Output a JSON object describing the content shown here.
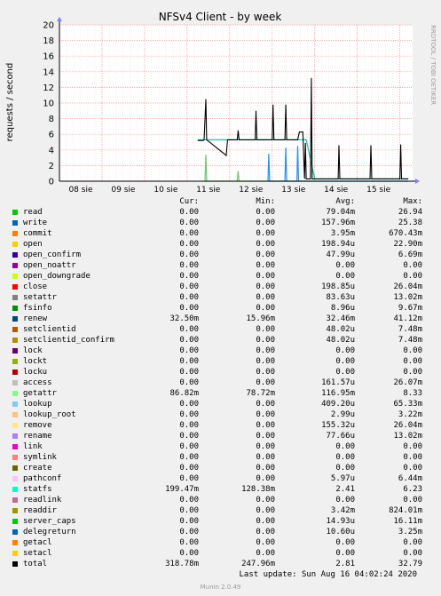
{
  "chart_data": {
    "type": "line",
    "title": "NFSv4 Client - by week",
    "ylabel": "requests / second",
    "watermark": "RRDTOOL / TOBI OETIKER",
    "ylim": [
      0,
      20
    ],
    "yticks": [
      0,
      2,
      4,
      6,
      8,
      10,
      12,
      14,
      16,
      18,
      20
    ],
    "xlim": [
      0,
      8.3
    ],
    "xticks": [
      {
        "label": "08 sie",
        "x": 0.5
      },
      {
        "label": "09 sie",
        "x": 1.5
      },
      {
        "label": "10 sie",
        "x": 2.5
      },
      {
        "label": "11 sie",
        "x": 3.5
      },
      {
        "label": "12 sie",
        "x": 4.5
      },
      {
        "label": "13 sie",
        "x": 5.5
      },
      {
        "label": "14 sie",
        "x": 6.5
      },
      {
        "label": "15 sie",
        "x": 7.5
      }
    ],
    "series": [
      {
        "name": "getattr",
        "color": "#66cc66",
        "points": [
          [
            3.4,
            0
          ],
          [
            3.42,
            0
          ],
          [
            3.44,
            3.4
          ],
          [
            3.46,
            0
          ],
          [
            4.1,
            0
          ],
          [
            4.18,
            0
          ],
          [
            4.2,
            1.3
          ],
          [
            4.22,
            0
          ],
          [
            6.5,
            0
          ],
          [
            8.2,
            0
          ]
        ]
      },
      {
        "name": "write",
        "color": "#1e90ff",
        "points": [
          [
            4.9,
            0
          ],
          [
            4.92,
            3.5
          ],
          [
            4.94,
            0
          ],
          [
            5.3,
            0
          ],
          [
            5.32,
            4.3
          ],
          [
            5.34,
            0
          ],
          [
            5.58,
            0
          ],
          [
            5.6,
            4.5
          ],
          [
            5.62,
            0
          ],
          [
            8.2,
            0
          ]
        ]
      },
      {
        "name": "statfs",
        "color": "#00ccaa",
        "points": [
          [
            3.25,
            5.3
          ],
          [
            3.38,
            5.3
          ],
          [
            3.92,
            5.3
          ],
          [
            4.0,
            5.3
          ],
          [
            5.8,
            5.3
          ],
          [
            6.0,
            0.3
          ],
          [
            8.2,
            0.3
          ]
        ]
      },
      {
        "name": "total",
        "color": "#000000",
        "points": [
          [
            3.25,
            5.2
          ],
          [
            3.38,
            5.2
          ],
          [
            3.4,
            5.3
          ],
          [
            3.44,
            10.5
          ],
          [
            3.46,
            5.3
          ],
          [
            3.92,
            3.3
          ],
          [
            3.95,
            5.3
          ],
          [
            4.18,
            5.3
          ],
          [
            4.2,
            6.5
          ],
          [
            4.22,
            5.3
          ],
          [
            4.6,
            5.3
          ],
          [
            4.62,
            9.0
          ],
          [
            4.64,
            5.3
          ],
          [
            5.0,
            5.3
          ],
          [
            5.02,
            9.8
          ],
          [
            5.04,
            5.3
          ],
          [
            5.3,
            5.3
          ],
          [
            5.32,
            9.8
          ],
          [
            5.34,
            5.3
          ],
          [
            5.6,
            5.3
          ],
          [
            5.64,
            6.3
          ],
          [
            5.72,
            6.3
          ],
          [
            5.76,
            0.3
          ],
          [
            5.78,
            4.9
          ],
          [
            5.8,
            0.3
          ],
          [
            5.9,
            0.3
          ],
          [
            5.92,
            13.2
          ],
          [
            5.94,
            0.3
          ],
          [
            6.5,
            0.3
          ],
          [
            6.55,
            0.3
          ],
          [
            6.57,
            4.6
          ],
          [
            6.59,
            0.3
          ],
          [
            7.3,
            0.3
          ],
          [
            7.32,
            4.6
          ],
          [
            7.34,
            0.3
          ],
          [
            8.0,
            0.3
          ],
          [
            8.02,
            4.7
          ],
          [
            8.04,
            0.3
          ],
          [
            8.2,
            0.3
          ]
        ]
      }
    ],
    "grid": true
  },
  "legend": {
    "headers": {
      "cur": "Cur:",
      "min": "Min:",
      "avg": "Avg:",
      "max": "Max:"
    },
    "rows": [
      {
        "name": "read",
        "color": "#00cc00",
        "cur": "0.00",
        "min": "0.00",
        "avg": "79.04m",
        "max": "26.94"
      },
      {
        "name": "write",
        "color": "#0066b3",
        "cur": "0.00",
        "min": "0.00",
        "avg": "157.96m",
        "max": "25.38"
      },
      {
        "name": "commit",
        "color": "#ff8000",
        "cur": "0.00",
        "min": "0.00",
        "avg": "3.95m",
        "max": "670.43m"
      },
      {
        "name": "open",
        "color": "#ffcc00",
        "cur": "0.00",
        "min": "0.00",
        "avg": "198.94u",
        "max": "22.90m"
      },
      {
        "name": "open_confirm",
        "color": "#330099",
        "cur": "0.00",
        "min": "0.00",
        "avg": "47.99u",
        "max": "6.69m"
      },
      {
        "name": "open_noattr",
        "color": "#990099",
        "cur": "0.00",
        "min": "0.00",
        "avg": "0.00",
        "max": "0.00"
      },
      {
        "name": "open_downgrade",
        "color": "#ccff00",
        "cur": "0.00",
        "min": "0.00",
        "avg": "0.00",
        "max": "0.00"
      },
      {
        "name": "close",
        "color": "#ff0000",
        "cur": "0.00",
        "min": "0.00",
        "avg": "198.85u",
        "max": "26.04m"
      },
      {
        "name": "setattr",
        "color": "#808080",
        "cur": "0.00",
        "min": "0.00",
        "avg": "83.63u",
        "max": "13.02m"
      },
      {
        "name": "fsinfo",
        "color": "#008f00",
        "cur": "0.00",
        "min": "0.00",
        "avg": "8.96u",
        "max": "9.67m"
      },
      {
        "name": "renew",
        "color": "#00487d",
        "cur": "32.50m",
        "min": "15.96m",
        "avg": "32.46m",
        "max": "41.12m"
      },
      {
        "name": "setclientid",
        "color": "#b35a00",
        "cur": "0.00",
        "min": "0.00",
        "avg": "48.02u",
        "max": "7.48m"
      },
      {
        "name": "setclientid_confirm",
        "color": "#b38f00",
        "cur": "0.00",
        "min": "0.00",
        "avg": "48.02u",
        "max": "7.48m"
      },
      {
        "name": "lock",
        "color": "#6b006b",
        "cur": "0.00",
        "min": "0.00",
        "avg": "0.00",
        "max": "0.00"
      },
      {
        "name": "lockt",
        "color": "#8fb300",
        "cur": "0.00",
        "min": "0.00",
        "avg": "0.00",
        "max": "0.00"
      },
      {
        "name": "locku",
        "color": "#b30000",
        "cur": "0.00",
        "min": "0.00",
        "avg": "0.00",
        "max": "0.00"
      },
      {
        "name": "access",
        "color": "#bebebe",
        "cur": "0.00",
        "min": "0.00",
        "avg": "161.57u",
        "max": "26.07m"
      },
      {
        "name": "getattr",
        "color": "#80ff80",
        "cur": "86.82m",
        "min": "78.72m",
        "avg": "116.95m",
        "max": "8.33"
      },
      {
        "name": "lookup",
        "color": "#80c9ff",
        "cur": "0.00",
        "min": "0.00",
        "avg": "409.20u",
        "max": "65.33m"
      },
      {
        "name": "lookup_root",
        "color": "#ffc080",
        "cur": "0.00",
        "min": "0.00",
        "avg": "2.99u",
        "max": "3.22m"
      },
      {
        "name": "remove",
        "color": "#ffe680",
        "cur": "0.00",
        "min": "0.00",
        "avg": "155.32u",
        "max": "26.04m"
      },
      {
        "name": "rename",
        "color": "#aa80ff",
        "cur": "0.00",
        "min": "0.00",
        "avg": "77.66u",
        "max": "13.02m"
      },
      {
        "name": "link",
        "color": "#ee00cc",
        "cur": "0.00",
        "min": "0.00",
        "avg": "0.00",
        "max": "0.00"
      },
      {
        "name": "symlink",
        "color": "#ff8080",
        "cur": "0.00",
        "min": "0.00",
        "avg": "0.00",
        "max": "0.00"
      },
      {
        "name": "create",
        "color": "#666600",
        "cur": "0.00",
        "min": "0.00",
        "avg": "0.00",
        "max": "0.00"
      },
      {
        "name": "pathconf",
        "color": "#ffbfff",
        "cur": "0.00",
        "min": "0.00",
        "avg": "5.97u",
        "max": "6.44m"
      },
      {
        "name": "statfs",
        "color": "#00ffcc",
        "cur": "199.47m",
        "min": "128.38m",
        "avg": "2.41",
        "max": "6.23"
      },
      {
        "name": "readlink",
        "color": "#cc6699",
        "cur": "0.00",
        "min": "0.00",
        "avg": "0.00",
        "max": "0.00"
      },
      {
        "name": "readdir",
        "color": "#999900",
        "cur": "0.00",
        "min": "0.00",
        "avg": "3.42m",
        "max": "824.01m"
      },
      {
        "name": "server_caps",
        "color": "#00cc00",
        "cur": "0.00",
        "min": "0.00",
        "avg": "14.93u",
        "max": "16.11m"
      },
      {
        "name": "delegreturn",
        "color": "#0066b3",
        "cur": "0.00",
        "min": "0.00",
        "avg": "10.60u",
        "max": "3.25m"
      },
      {
        "name": "getacl",
        "color": "#ff8000",
        "cur": "0.00",
        "min": "0.00",
        "avg": "0.00",
        "max": "0.00"
      },
      {
        "name": "setacl",
        "color": "#ffcc00",
        "cur": "0.00",
        "min": "0.00",
        "avg": "0.00",
        "max": "0.00"
      },
      {
        "name": "total",
        "color": "#000000",
        "cur": "318.78m",
        "min": "247.96m",
        "avg": "2.81",
        "max": "32.79"
      }
    ]
  },
  "footer": {
    "last_update": "Last update: Sun Aug 16 04:02:24 2020",
    "version": "Munin 2.0.49"
  }
}
